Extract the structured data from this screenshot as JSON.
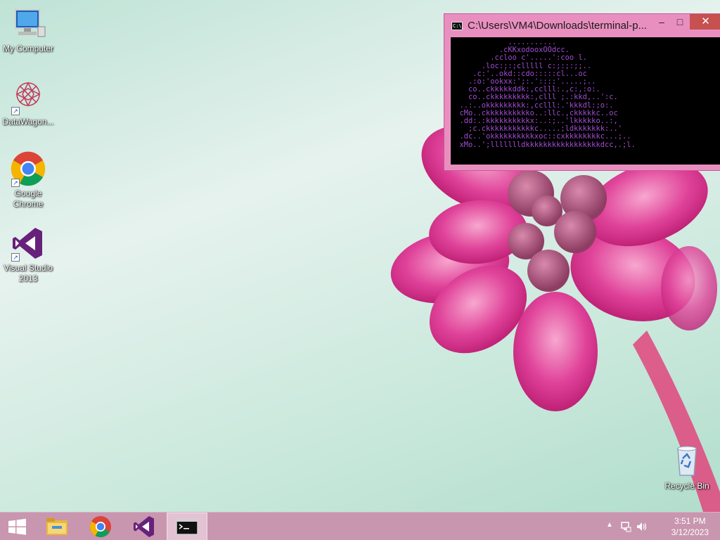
{
  "desktop": {
    "icons": [
      {
        "label": "My Computer"
      },
      {
        "label": "DataWagon..."
      },
      {
        "label": "Google Chrome"
      },
      {
        "label": "Visual Studio 2013"
      }
    ],
    "recycle_bin": {
      "label": "Recycle Bin"
    }
  },
  "console": {
    "title": "C:\\Users\\VM4\\Downloads\\terminal-p...",
    "icon_text": "C:\\_",
    "controls": {
      "minimize": "–",
      "maximize": "□",
      "close": "✕"
    },
    "ascii_art": "             ...........\n           .cKKxodooxOOdcc.\n         .ccloo c'.....':coo l.\n       .loc:;:;clllll c:;:;:;;..\n     .c:'..okd::cdo:::::cl...oc\n    .:o:'ookxx:';:.'::::'.....;..\n    co..ckkkkkddk:,cclll:.,c:,:o:.\n    co..ckkkkkkkkk:,clll ;.:kkd,..':c.\n  ..:..okkkkkkkkk:,cclll:.'kkkdl:;o:.\n  cMo..ckkkkkkkkkko..:llc.,ckkkkkc..oc\n  .dd:.:kkkkkkkkkkx:..:;..'lkkkkko..:,\n    ;c.ckkkkkkkkkkkc.....;ldkkkkkkk:..'\n  .dc..'okkkkkkkkkkxoc::cxkkkkkkkkc...;..\n  xMo..';llllllldkkkkkkkkkkkkkkkkkdcc,.;l."
  },
  "taskbar": {
    "items": [
      {
        "name": "start",
        "icon": "windows-logo-icon"
      },
      {
        "name": "file-explorer",
        "icon": "folder-icon"
      },
      {
        "name": "chrome",
        "icon": "chrome-icon"
      },
      {
        "name": "visual-studio",
        "icon": "visual-studio-icon"
      },
      {
        "name": "command-prompt",
        "icon": "console-icon",
        "active": true
      }
    ],
    "clock": {
      "time": "3:51 PM",
      "date": "3/12/2023"
    }
  }
}
